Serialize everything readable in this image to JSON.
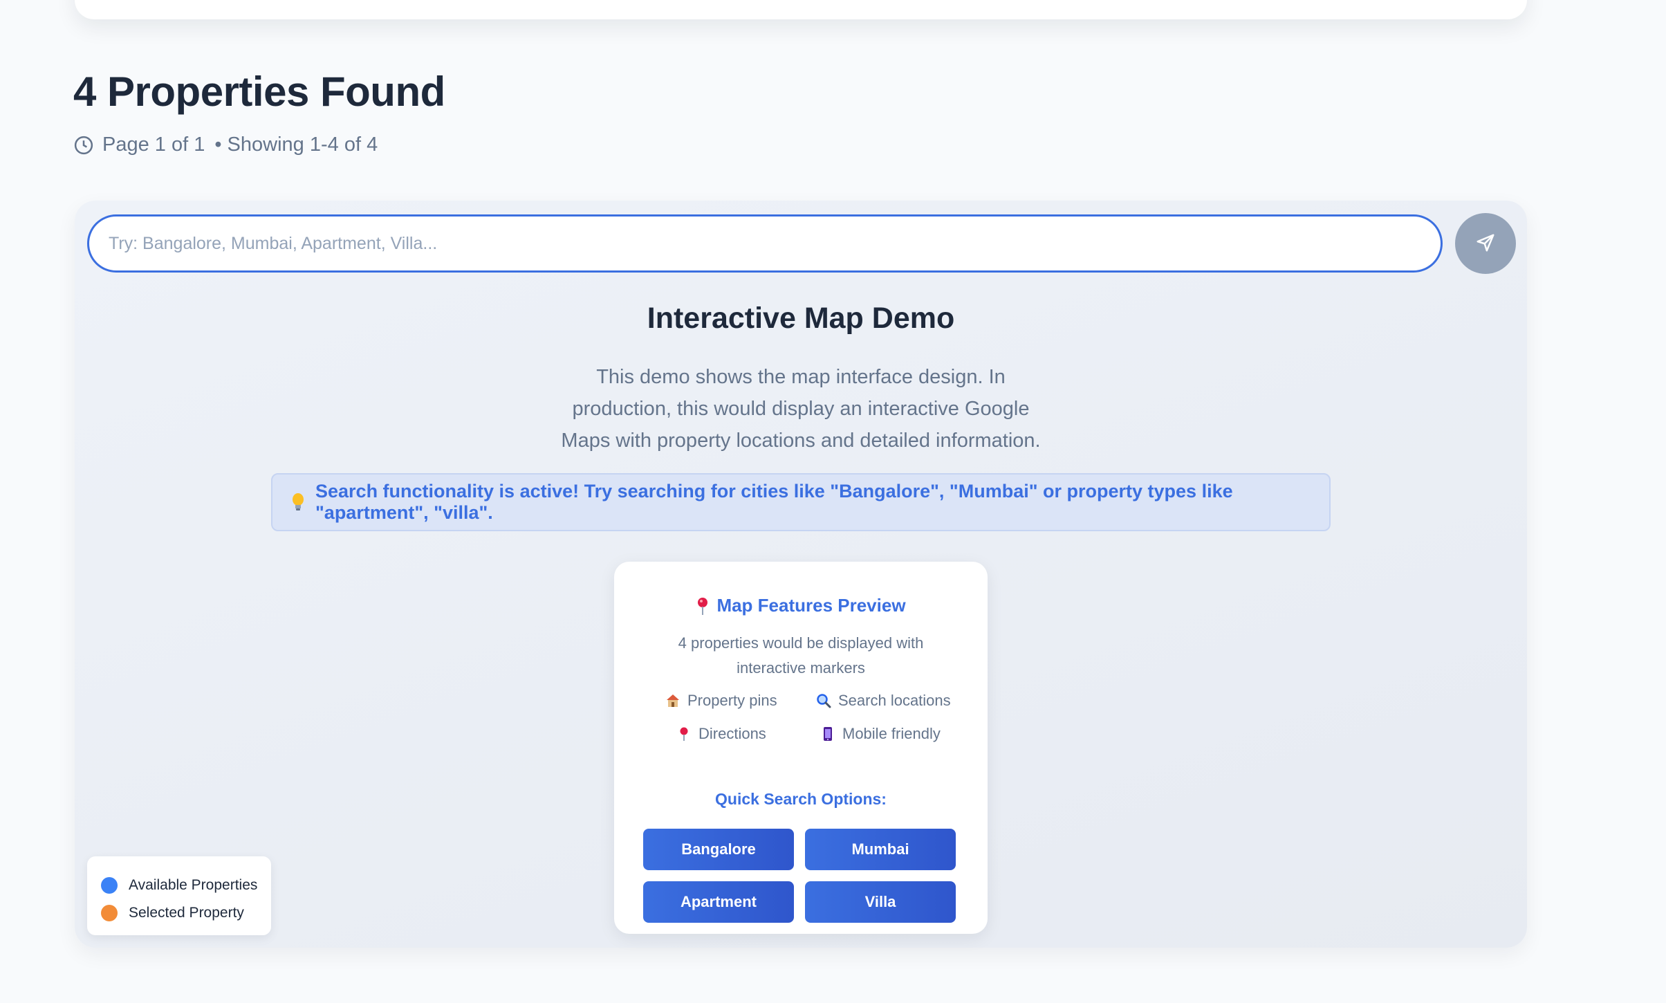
{
  "results": {
    "title": "4 Properties Found",
    "page_info": "Page 1 of 1",
    "showing": "• Showing 1-4 of 4"
  },
  "search": {
    "placeholder": "Try: Bangalore, Mumbai, Apartment, Villa..."
  },
  "demo": {
    "title": "Interactive Map Demo",
    "description": "This demo shows the map interface design. In production, this would display an interactive Google Maps with property locations and detailed information."
  },
  "banner": {
    "icon": "lightbulb-icon",
    "text": "Search functionality is active! Try searching for cities like \"Bangalore\", \"Mumbai\" or property types like \"apartment\", \"villa\"."
  },
  "features": {
    "heading": "Map Features Preview",
    "description": "4 properties would be displayed with interactive markers",
    "items": [
      {
        "icon": "house-icon",
        "label": "Property pins"
      },
      {
        "icon": "magnifier-icon",
        "label": "Search locations"
      },
      {
        "icon": "pin-icon",
        "label": "Directions"
      },
      {
        "icon": "mobile-icon",
        "label": "Mobile friendly"
      }
    ],
    "quick_label": "Quick Search Options:",
    "quick_options": [
      "Bangalore",
      "Mumbai",
      "Apartment",
      "Villa"
    ]
  },
  "legend": {
    "items": [
      {
        "label": "Available Properties",
        "color": "#3b82f6"
      },
      {
        "label": "Selected Property",
        "color": "#f28c38"
      }
    ]
  },
  "colors": {
    "accent": "#3b6fe0",
    "send_button": "#94a3b8"
  }
}
